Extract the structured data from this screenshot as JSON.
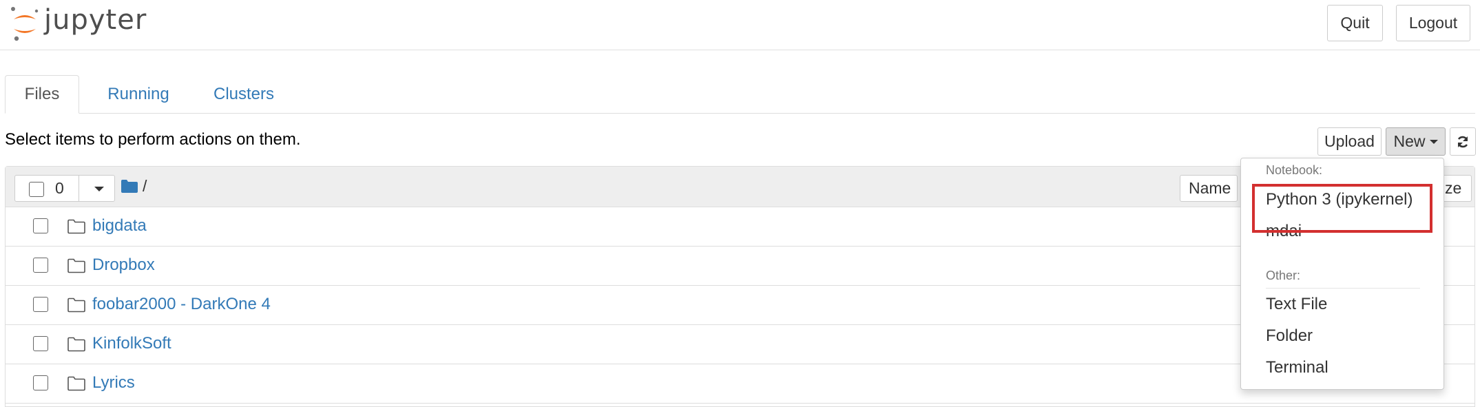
{
  "header": {
    "logo_text": "jupyter",
    "quit_label": "Quit",
    "logout_label": "Logout",
    "logo_colors": {
      "orange": "#f37626",
      "gray": "#767677"
    }
  },
  "tabs": [
    {
      "label": "Files",
      "active": true
    },
    {
      "label": "Running",
      "active": false
    },
    {
      "label": "Clusters",
      "active": false
    }
  ],
  "toolbar": {
    "instructions": "Select items to perform actions on them.",
    "upload_label": "Upload",
    "new_label": "New",
    "refresh_icon": "refresh-icon"
  },
  "list_header": {
    "selected_count": "0",
    "breadcrumb": "/",
    "name_sort_label": "Name",
    "size_sort_label": "ze"
  },
  "files": [
    {
      "name": "bigdata",
      "type": "folder"
    },
    {
      "name": "Dropbox",
      "type": "folder"
    },
    {
      "name": "foobar2000 - DarkOne 4",
      "type": "folder"
    },
    {
      "name": "KinfolkSoft",
      "type": "folder"
    },
    {
      "name": "Lyrics",
      "type": "folder"
    }
  ],
  "new_menu": {
    "notebook_header": "Notebook:",
    "notebook_items": [
      "Python 3 (ipykernel)",
      "mdai"
    ],
    "other_header": "Other:",
    "other_items": [
      "Text File",
      "Folder",
      "Terminal"
    ],
    "highlight_color": "#d32f2f"
  },
  "colors": {
    "link": "#337ab7",
    "folder_icon": "#337ab7"
  }
}
